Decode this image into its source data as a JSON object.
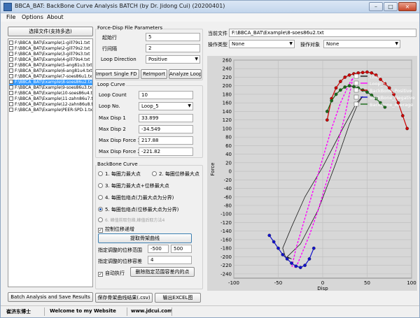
{
  "window": {
    "title": "BBCA_BAT: BackBone Curve Analysis BATCH (by Dr. Jidong Cui) (20200401)",
    "min": "–",
    "max": "□",
    "close": "×"
  },
  "menu": [
    "File",
    "Options",
    "About"
  ],
  "left": {
    "select_button": "选择文件(支持多选)",
    "batch_button": "Batch Analysis and Save Results",
    "files": [
      {
        "text": "F:\\BBCA_BAT\\Example\\1-gill79s1.txt",
        "selected": false
      },
      {
        "text": "F:\\BBCA_BAT\\Example\\2-gill79s2.txt",
        "selected": false
      },
      {
        "text": "F:\\BBCA_BAT\\Example\\3-gill79s3.txt",
        "selected": false
      },
      {
        "text": "F:\\BBCA_BAT\\Example\\4-gill79s4.txt",
        "selected": false
      },
      {
        "text": "F:\\BBCA_BAT\\Example\\5-ang81u3.txt",
        "selected": false
      },
      {
        "text": "F:\\BBCA_BAT\\Example\\6-ang81u4.txt",
        "selected": false
      },
      {
        "text": "F:\\BBCA_BAT\\Example\\7-soes86u1.txt",
        "selected": false
      },
      {
        "text": "F:\\BBCA_BAT\\Example\\8-soes86u2.txt",
        "selected": true
      },
      {
        "text": "F:\\BBCA_BAT\\Example\\9-soes86u3.txt",
        "selected": false
      },
      {
        "text": "F:\\BBCA_BAT\\Example\\10-soes86u4.txt",
        "selected": false
      },
      {
        "text": "F:\\BBCA_BAT\\Example\\11-zahn86u7.txt",
        "selected": false
      },
      {
        "text": "F:\\BBCA_BAT\\Example\\12-zahn86u8.txt",
        "selected": false
      },
      {
        "text": "F:\\BBCA_BAT\\Example\\PEER-SPD-1.txt",
        "selected": false
      }
    ]
  },
  "params": {
    "group_title": "Force-Disp File Parameters",
    "start_row_label": "起始行",
    "start_row_value": "5",
    "row_interval_label": "行间隔",
    "row_interval_value": "2",
    "loop_direction_label": "Loop Direction",
    "loop_direction_value": "Positive",
    "import_button": "Import Single FD File",
    "reimport_button": "ReImport",
    "analyze_button": "Analyze Loop"
  },
  "loop": {
    "group_title": "Loop Curve",
    "count_label": "Loop Count",
    "count_value": "10",
    "no_label": "Loop No.",
    "no_value": "Loop_5",
    "max_disp1_label": "Max Disp 1",
    "max_disp1_value": "33.899",
    "max_disp2_label": "Max Disp 2",
    "max_disp2_value": "-34.549",
    "max_force1_label": "Max Disp Force 1",
    "max_force1_value": "217.88",
    "max_force2_label": "Max Disp Force 2",
    "max_force2_value": "-221.82"
  },
  "backbone": {
    "group_title": "BackBone Curve",
    "opt1": "1. 每圈力最大点",
    "opt2": "2. 每圈位移最大点",
    "opt3": "3. 每圈力最大点+位移最大点",
    "opt4": "4. 每圈包络点(力最大点为分界)",
    "opt5": "5. 每圈包络点(位移最大点为分界)",
    "opt6": "6. 峰值前取包络,峰值后取方法4",
    "control_disp": "控制位移递增",
    "extract_button": "提取骨架曲线",
    "range_label": "指定调整的位移范围",
    "range_min": "-500",
    "range_max": "500",
    "tol_label": "指定调整的位移容差",
    "tol_value": "4",
    "auto_label": "自动执行",
    "delete_button": "删除指定范围容差内的点",
    "save_button": "保存骨架曲线结果(.csv)",
    "export_button": "输出EXCEL图"
  },
  "right": {
    "current_file_label": "当前文件",
    "current_file_value": "F:\\BBCA_BAT\\Example\\8-soes86u2.txt",
    "op_type_label": "操作类型",
    "op_type_value": "None",
    "op_target_label": "操作对象",
    "op_target_value": "None"
  },
  "status": {
    "author": "崔济东博士",
    "welcome": "Welcome to my Website",
    "site": "www.jdcui.com"
  },
  "chart_data": {
    "type": "line",
    "title": "",
    "xlabel": "Disp",
    "ylabel": "Force",
    "xlim": [
      -100,
      100
    ],
    "ylim": [
      -250,
      250
    ],
    "x_ticks": [
      -100,
      -50,
      0,
      50,
      100
    ],
    "y_ticks": [
      260,
      240,
      220,
      200,
      180,
      160,
      140,
      120,
      100,
      80,
      60,
      40,
      20,
      0,
      -20,
      -40,
      -60,
      -80,
      -100,
      -120,
      -140,
      -160,
      -180,
      -200,
      -220,
      -240
    ],
    "grid": true,
    "legend_position": "top-right",
    "colors": {
      "loop": "#1a1a1a",
      "loop5": "#ff00ff",
      "pos": "#cc0000",
      "neg": "#1010cc",
      "avg": "#1a6b1a",
      "bg": "#d7d7d7"
    },
    "series": [
      {
        "name": "Loop",
        "x": [
          -40,
          -25,
          -5,
          15,
          30,
          40,
          45,
          38,
          20,
          0,
          -20,
          -35,
          -45,
          -42,
          -35,
          -40
        ],
        "y": [
          -200,
          -170,
          -90,
          20,
          110,
          160,
          175,
          160,
          90,
          10,
          -60,
          -130,
          -180,
          -200,
          -205,
          -200
        ]
      },
      {
        "name": "Loop_5",
        "x": [
          -30,
          -25,
          -15,
          -5,
          5,
          15,
          25,
          33.9,
          30,
          20,
          10,
          0,
          -10,
          -20,
          -30,
          -34.5,
          -30
        ],
        "y": [
          -225,
          -200,
          -150,
          -90,
          -20,
          50,
          130,
          218,
          205,
          160,
          100,
          30,
          -40,
          -110,
          -180,
          -222,
          -225
        ]
      },
      {
        "name": "BackBone_Positive",
        "x": [
          5,
          10,
          15,
          20,
          25,
          30,
          35,
          40,
          45,
          50,
          55,
          60,
          65,
          70,
          75,
          80,
          85,
          90,
          95
        ],
        "y": [
          120,
          170,
          195,
          210,
          220,
          225,
          228,
          230,
          231,
          232,
          230,
          225,
          215,
          205,
          195,
          180,
          160,
          130,
          100
        ]
      },
      {
        "name": "BackBone_Negative",
        "x": [
          -60,
          -55,
          -50,
          -45,
          -40,
          -35,
          -30,
          -25,
          -20,
          -15,
          -10
        ],
        "y": [
          -150,
          -165,
          -180,
          -195,
          -205,
          -215,
          -222,
          -225,
          -220,
          -205,
          -180
        ]
      },
      {
        "name": "BackBone_Average",
        "x": [
          5,
          10,
          15,
          20,
          25,
          30,
          35,
          40,
          45,
          50,
          55,
          60,
          65,
          70
        ],
        "y": [
          140,
          165,
          180,
          190,
          197,
          200,
          198,
          195,
          190,
          185,
          178,
          170,
          160,
          150
        ]
      }
    ]
  }
}
